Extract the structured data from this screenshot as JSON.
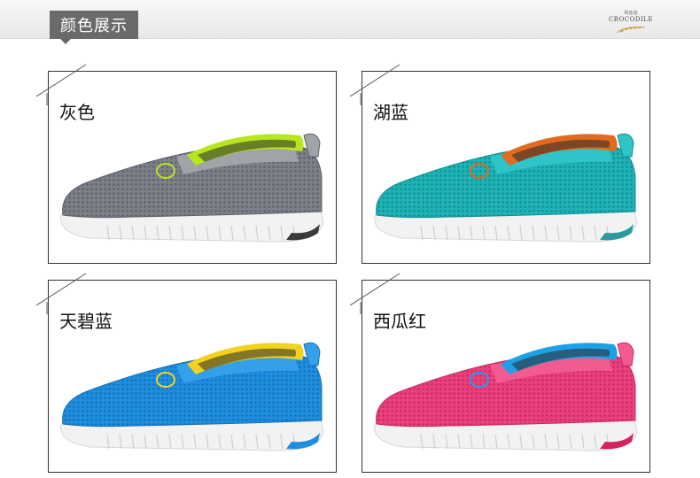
{
  "header": {
    "section_title": "颜色展示",
    "brand_small": "鳄鱼恤",
    "brand_name": "CROCODILE"
  },
  "colors": [
    {
      "label": "灰色",
      "upper": "#7d8088",
      "upper_dark": "#5e6168",
      "collar": "#a0a3a8",
      "trim": "#b7e621",
      "sole": "#f2f2f2",
      "sole_accent": "#3a3a3a"
    },
    {
      "label": "湖蓝",
      "upper": "#1fb3b7",
      "upper_dark": "#138d91",
      "collar": "#2fc4c8",
      "trim": "#e06b21",
      "sole": "#f2f2f2",
      "sole_accent": "#2a9aa0"
    },
    {
      "label": "天碧蓝",
      "upper": "#1e8ee0",
      "upper_dark": "#1670b5",
      "collar": "#34a0ea",
      "trim": "#f2d21e",
      "sole": "#f2f2f2",
      "sole_accent": "#1e8ee0"
    },
    {
      "label": "西瓜红",
      "upper": "#ec3f7e",
      "upper_dark": "#c42c62",
      "collar": "#f15b90",
      "trim": "#1f9fe6",
      "sole": "#f2f2f2",
      "sole_accent": "#d4245f"
    }
  ]
}
